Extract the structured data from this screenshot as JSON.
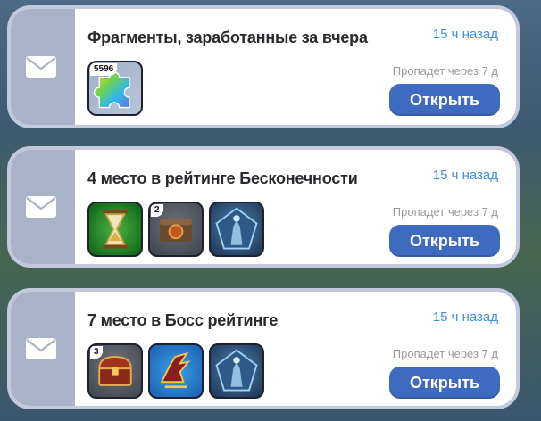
{
  "mails": [
    {
      "title": "Фрагменты, заработанные за вчера",
      "time": "15 ч назад",
      "expiry": "Пропадет через 7 д",
      "button": "Открыть",
      "rewards": [
        {
          "icon": "puzzle-fragment-icon",
          "count": "5596"
        }
      ]
    },
    {
      "title": "4 место в рейтинге Бесконечности",
      "time": "15 ч назад",
      "expiry": "Пропадет через 7 д",
      "button": "Открыть",
      "rewards": [
        {
          "icon": "hourglass-icon",
          "count": ""
        },
        {
          "icon": "scroll-chest-icon",
          "count": "2"
        },
        {
          "icon": "hero-pentagon-icon",
          "count": ""
        }
      ]
    },
    {
      "title": "7 место в Босс рейтинге",
      "time": "15 ч назад",
      "expiry": "Пропадет через 7 д",
      "button": "Открыть",
      "rewards": [
        {
          "icon": "treasure-chest-icon",
          "count": "3"
        },
        {
          "icon": "winged-boots-icon",
          "count": ""
        },
        {
          "icon": "hero-pentagon-icon",
          "count": ""
        }
      ]
    }
  ],
  "colors": {
    "button_bg": "#3e6bbf",
    "time_text": "#3d8fe0",
    "envelope_panel": "#a9b2c9"
  }
}
